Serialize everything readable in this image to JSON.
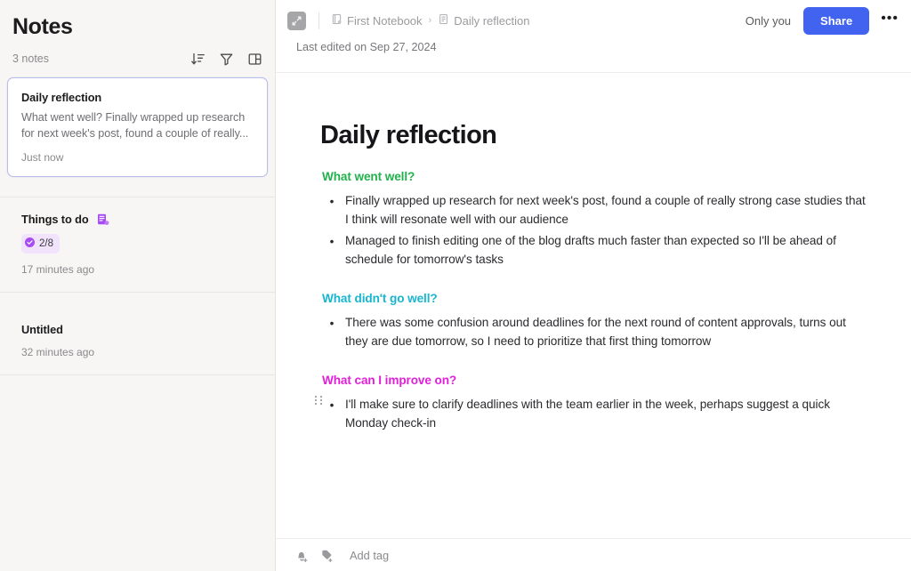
{
  "sidebar": {
    "title": "Notes",
    "count_label": "3 notes",
    "tools": [
      {
        "name": "sort-icon",
        "label": "Sort"
      },
      {
        "name": "filter-icon",
        "label": "Filter"
      },
      {
        "name": "layout-icon",
        "label": "Layout"
      }
    ],
    "notes": [
      {
        "title": "Daily reflection",
        "snippet": "What went well? Finally wrapped up research for next week's post, found a couple of really...",
        "time": "Just now",
        "selected": true
      },
      {
        "title": "Things to do",
        "todo_count": "2/8",
        "time": "17 minutes ago",
        "selected": false
      },
      {
        "title": "Untitled",
        "time": "32 minutes ago",
        "selected": false
      }
    ]
  },
  "topbar": {
    "collapse_icon": "collapse-panel-icon",
    "breadcrumb": [
      {
        "label": "First Notebook",
        "icon": "notebook-icon"
      },
      {
        "label": "Daily reflection",
        "icon": "note-icon"
      }
    ],
    "separator": "›",
    "visibility_label": "Only you",
    "share_label": "Share",
    "more_label": "•••"
  },
  "document": {
    "last_edited": "Last edited on Sep 27, 2024",
    "title": "Daily reflection",
    "sections": [
      {
        "heading": "What went well?",
        "color": "#22b14c",
        "bullets": [
          "Finally wrapped up research for next week's post, found a couple of really strong case studies that I think will resonate well with our audience",
          "Managed to finish editing one of the blog drafts much faster than expected so I'll be ahead of schedule for tomorrow's tasks"
        ]
      },
      {
        "heading": "What didn't go well?",
        "color": "#18b5cf",
        "bullets": [
          "There was some confusion around deadlines for the next round of content approvals, turns out they are due tomorrow, so I need to prioritize that first thing tomorrow"
        ]
      },
      {
        "heading": "What can I improve on?",
        "color": "#e020d8",
        "bullets": [
          "I'll make sure to clarify deadlines with the team earlier in the week, perhaps suggest a quick Monday check-in"
        ]
      }
    ]
  },
  "bottombar": {
    "reminder_icon": "add-reminder-icon",
    "tag_icon": "add-tag-icon",
    "add_tag_label": "Add tag"
  },
  "colors": {
    "accent_blue": "#4263f0",
    "purple": "#a game"
  }
}
